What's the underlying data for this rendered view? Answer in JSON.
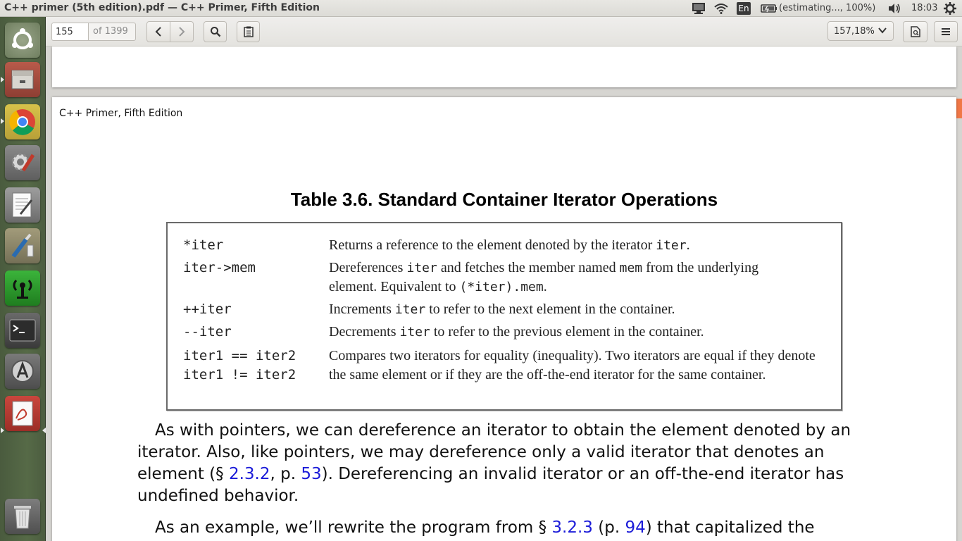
{
  "window": {
    "title": "C++ primer (5th edition).pdf — C++ Primer, Fifth Edition"
  },
  "tray": {
    "lang": "En",
    "battery_text": "(estimating..., 100%)",
    "clock": "18:03"
  },
  "launcher": {
    "items": [
      {
        "name": "Ubuntu Dash"
      },
      {
        "name": "Files"
      },
      {
        "name": "Chrome"
      },
      {
        "name": "System Settings"
      },
      {
        "name": "Text Editor"
      },
      {
        "name": "Drawing"
      },
      {
        "name": "Wireless Tool"
      },
      {
        "name": "Terminal"
      },
      {
        "name": "Software Updater"
      },
      {
        "name": "Document Viewer"
      },
      {
        "name": "Trash"
      }
    ]
  },
  "toolbar": {
    "page_number": "155",
    "page_total": "of 1399",
    "zoom": "157,18%"
  },
  "document": {
    "running_head": "C++ Primer, Fifth Edition",
    "table_title": "Table 3.6. Standard Container Iterator Operations",
    "table": {
      "r1_op": "*iter",
      "r1_a": "Returns a reference to the element denoted by the iterator ",
      "r1_code": "iter",
      "r1_b": ".",
      "r2_op": "iter->mem",
      "r2_a": "Dereferences ",
      "r2_code1": "iter",
      "r2_b": " and fetches the member named ",
      "r2_code2": "mem",
      "r2_c": " from the underlying element. Equivalent to ",
      "r2_code3": "(*iter).mem",
      "r2_d": ".",
      "r3_op": "++iter",
      "r3_a": "Increments ",
      "r3_code": "iter",
      "r3_b": " to refer to the next element in the container.",
      "r4_op": "--iter",
      "r4_a": "Decrements ",
      "r4_code": "iter",
      "r4_b": " to refer to the previous element in the container.",
      "r5_op1": "iter1 == iter2",
      "r5_op2": "iter1 != iter2",
      "r5_desc": "Compares two iterators for equality (inequality). Two iterators are equal if they denote the same element or if they are the off-the-end iterator for the same container."
    },
    "para1": {
      "a": "As with pointers, we can dereference an iterator to obtain the element denoted by an iterator. Also, like pointers, we may dereference only a valid iterator that denotes an element (§ ",
      "link1": "2.3.2",
      "b": ", p. ",
      "link2": "53",
      "c": "). Dereferencing an invalid iterator or an off-the-end iterator has undefined behavior."
    },
    "para2": {
      "a": "As an example, we’ll rewrite the program from § ",
      "link1": "3.2.3",
      "b": " (p. ",
      "link2": "94",
      "c": ") that capitalized the"
    }
  }
}
